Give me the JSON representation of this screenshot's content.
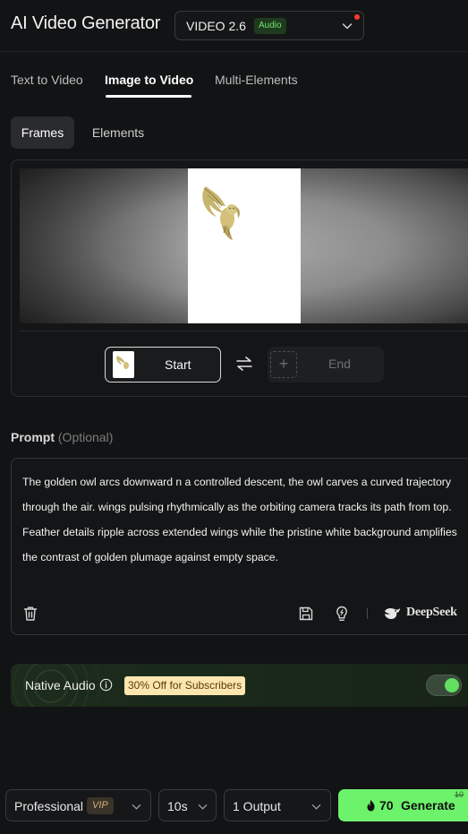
{
  "header": {
    "title": "AI Video Generator",
    "model_name": "VIDEO 2.6",
    "model_badge": "Audio"
  },
  "tabs": [
    {
      "label": "Text to Video"
    },
    {
      "label": "Image to Video",
      "active": true
    },
    {
      "label": "Multi-Elements"
    }
  ],
  "segmented": {
    "frames": "Frames",
    "elements": "Elements",
    "active": "Frames"
  },
  "frames": {
    "start_label": "Start",
    "end_label": "End",
    "end_plus": "+"
  },
  "prompt": {
    "label": "Prompt",
    "optional": "(Optional)",
    "text": "The golden owl arcs downward n a controlled descent, the owl carves a curved trajectory through the air. wings pulsing rhythmically as the orbiting camera tracks its path from top. Feather details ripple across extended wings while the pristine white background amplifies the contrast of golden plumage against empty space.",
    "provider": "DeepSeek"
  },
  "audio": {
    "label": "Native Audio",
    "promo": "30% Off for Subscribers",
    "enabled": true
  },
  "bottom": {
    "quality": "Professional",
    "quality_badge": "VIP",
    "duration": "10s",
    "outputs": "1 Output",
    "cost": "70",
    "generate": "Generate",
    "old_cost": "10"
  },
  "colors": {
    "background": "#121314",
    "accent_green": "#6df26b",
    "audio_badge_text": "#6fe06f",
    "promo_bg": "#fbe6b0",
    "notification_dot": "#ff3b30"
  },
  "icons": [
    "chevron-down-icon",
    "swap-icon",
    "trash-icon",
    "save-icon",
    "lightbulb-icon",
    "deepseek-whale-icon",
    "info-icon",
    "fire-icon"
  ]
}
